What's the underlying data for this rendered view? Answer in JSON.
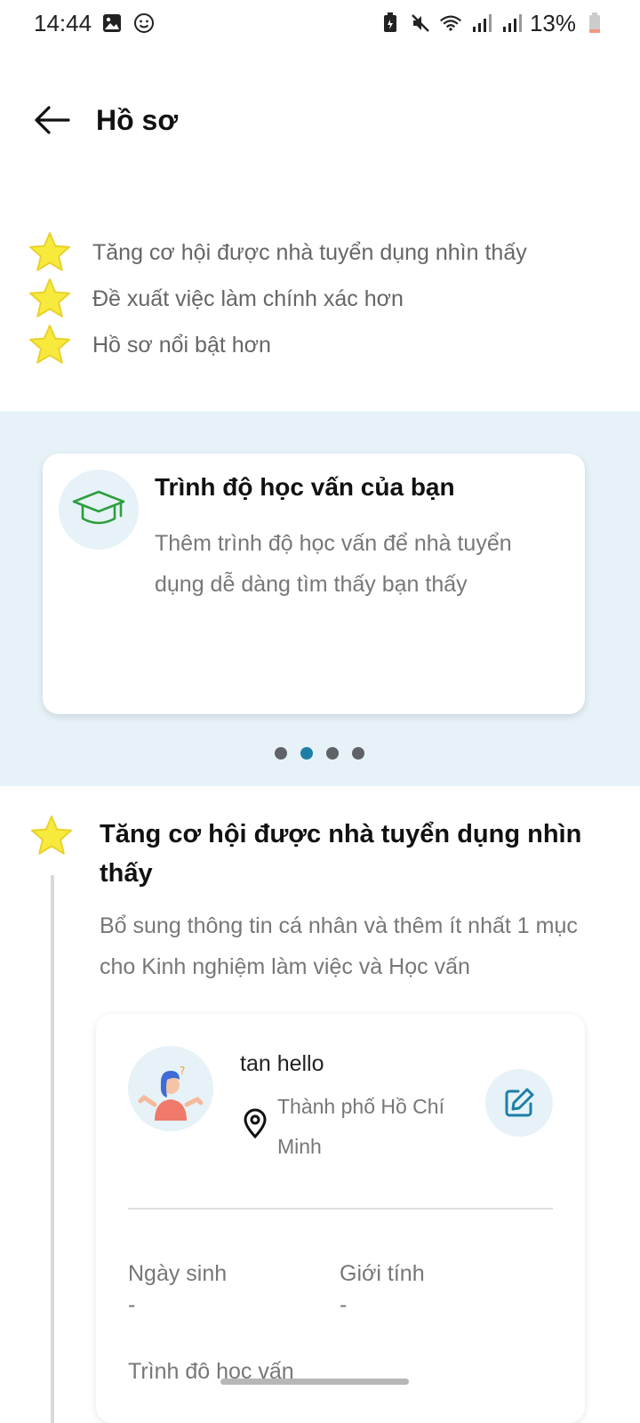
{
  "status_bar": {
    "time": "14:44",
    "battery": "13%",
    "icons_left": [
      "image-icon",
      "smiley-icon"
    ],
    "icons_right": [
      "battery-saver-icon",
      "mute-icon",
      "wifi-icon",
      "signal-icon",
      "signal-icon"
    ]
  },
  "header": {
    "title": "Hồ sơ"
  },
  "benefits": [
    {
      "text": "Tăng cơ hội được nhà tuyển dụng nhìn thấy"
    },
    {
      "text": "Đề xuất việc làm chính xác hơn"
    },
    {
      "text": "Hồ sơ nổi bật hơn"
    }
  ],
  "carousel": {
    "card_title": "Trình độ học vấn của bạn",
    "card_desc": "Thêm trình độ học vấn để nhà tuyển dụng dễ dàng tìm thấy bạn thấy",
    "dots": 4,
    "active_dot": 2
  },
  "section": {
    "title": "Tăng cơ hội được nhà tuyển dụng nhìn thấy",
    "desc": "Bổ sung thông tin cá nhân và thêm ít nhất 1 mục cho Kinh nghiệm làm việc và Học vấn"
  },
  "profile": {
    "name": "tan hello",
    "location": "Thành phố Hồ Chí Minh",
    "birth_label": "Ngày sinh",
    "birth_value": "-",
    "gender_label": "Giới tính",
    "gender_value": "-",
    "third_label": "Trình độ học vấn"
  },
  "colors": {
    "accent": "#1e7fa6",
    "star": "#f7ea3c",
    "carousel_bg": "#e6f2f8",
    "edu_icon": "#2e9e3e"
  }
}
